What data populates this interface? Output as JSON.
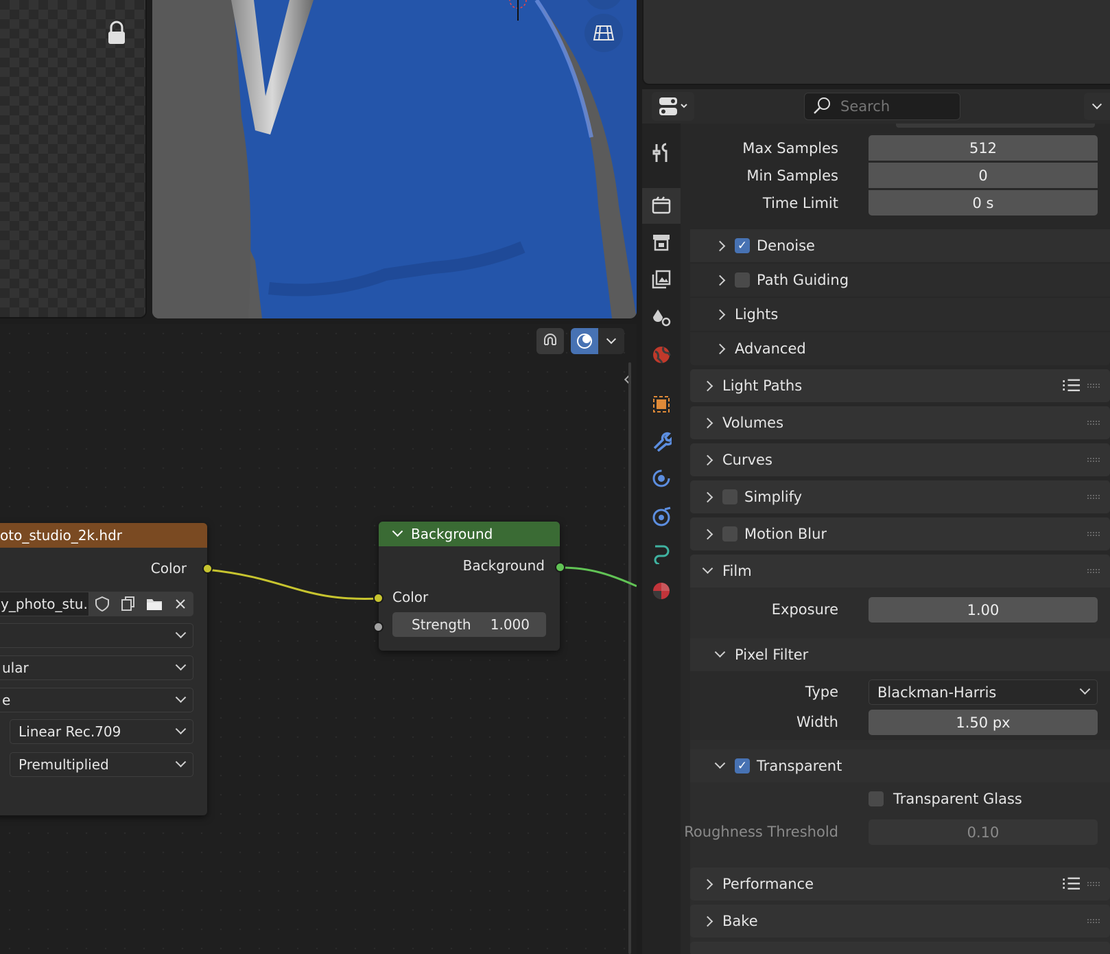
{
  "colors": {
    "viewport_blue": "#2553a6",
    "node_header_brown": "#7a4a22",
    "node_header_green": "#3a6b34",
    "socket_yellow": "#c7c42f",
    "socket_green": "#61c355",
    "socket_gray": "#a1a1a1",
    "checkbox_blue": "#4772b3"
  },
  "viewport": {
    "lock_icon": "lock-icon",
    "grid_icon": "perspective-grid-icon"
  },
  "node_editor": {
    "toolbar": {
      "snap_icon": "magnet-icon",
      "overlay_icon": "overlay-icon"
    },
    "image_node": {
      "title": "oto_studio_2k.hdr",
      "output_color": "Color",
      "image_name": "y_photo_stu...",
      "dropdowns": [
        "",
        "ular",
        "e",
        "Linear Rec.709",
        "Premultiplied"
      ]
    },
    "background_node": {
      "title": "Background",
      "output_label": "Background",
      "input_color": "Color",
      "strength_label": "Strength",
      "strength_value": "1.000"
    }
  },
  "properties": {
    "search_placeholder": "Search",
    "sampling": {
      "max_samples_label": "Max Samples",
      "max_samples": "512",
      "min_samples_label": "Min Samples",
      "min_samples": "0",
      "time_limit_label": "Time Limit",
      "time_limit": "0 s"
    },
    "sub_panels": {
      "denoise": "Denoise",
      "path_guiding": "Path Guiding",
      "lights": "Lights",
      "advanced": "Advanced"
    },
    "panels": {
      "light_paths": "Light Paths",
      "volumes": "Volumes",
      "curves": "Curves",
      "simplify": "Simplify",
      "motion_blur": "Motion Blur",
      "film": "Film",
      "performance": "Performance",
      "bake": "Bake"
    },
    "film": {
      "exposure_label": "Exposure",
      "exposure": "1.00",
      "pixel_filter": "Pixel Filter",
      "type_label": "Type",
      "type_value": "Blackman-Harris",
      "width_label": "Width",
      "width_value": "1.50 px",
      "transparent": "Transparent",
      "transparent_glass": "Transparent Glass",
      "roughness_label": "Roughness Threshold",
      "roughness": "0.10"
    }
  }
}
